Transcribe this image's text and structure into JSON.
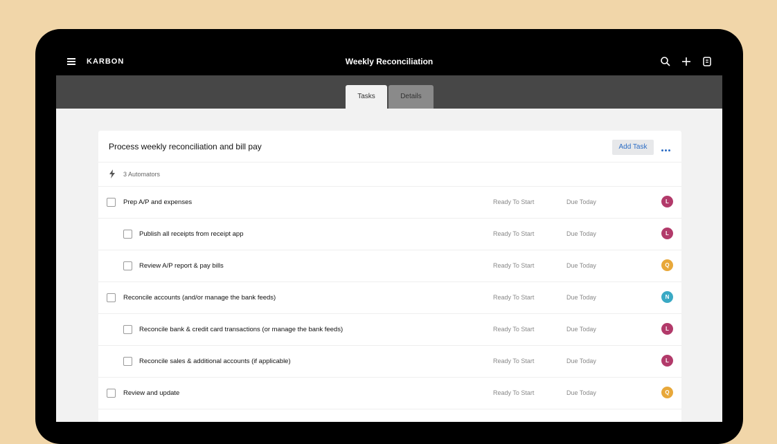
{
  "app": {
    "brand": "KARBON",
    "title": "Weekly Reconciliation",
    "icons": [
      "menu-icon",
      "search-icon",
      "plus-icon",
      "notes-icon"
    ]
  },
  "tabs": [
    {
      "label": "Tasks",
      "active": true
    },
    {
      "label": "Details",
      "active": false
    }
  ],
  "card": {
    "title": "Process weekly reconciliation and bill pay",
    "add_task_label": "Add Task",
    "automators_label": "3 Automators"
  },
  "tasks": [
    {
      "name": "Prep A/P and expenses",
      "level": "parent",
      "status": "Ready To Start",
      "due": "Due Today",
      "assignee": "L",
      "color": "#b23a6a"
    },
    {
      "name": "Publish all receipts from receipt app",
      "level": "child",
      "status": "Ready To Start",
      "due": "Due Today",
      "assignee": "L",
      "color": "#b23a6a"
    },
    {
      "name": "Review A/P report & pay bills",
      "level": "child",
      "status": "Ready To Start",
      "due": "Due Today",
      "assignee": "Q",
      "color": "#e8a83a"
    },
    {
      "name": "Reconcile accounts (and/or manage the bank feeds)",
      "level": "parent",
      "status": "Ready To Start",
      "due": "Due Today",
      "assignee": "N",
      "color": "#3aa9c4"
    },
    {
      "name": "Reconcile bank & credit card transactions (or manage the bank feeds)",
      "level": "child",
      "status": "Ready To Start",
      "due": "Due Today",
      "assignee": "L",
      "color": "#b23a6a"
    },
    {
      "name": "Reconcile sales & additional accounts (if applicable)",
      "level": "child",
      "status": "Ready To Start",
      "due": "Due Today",
      "assignee": "L",
      "color": "#b23a6a"
    },
    {
      "name": "Review and update",
      "level": "parent",
      "status": "Ready To Start",
      "due": "Due Today",
      "assignee": "Q",
      "color": "#e8a83a"
    }
  ]
}
